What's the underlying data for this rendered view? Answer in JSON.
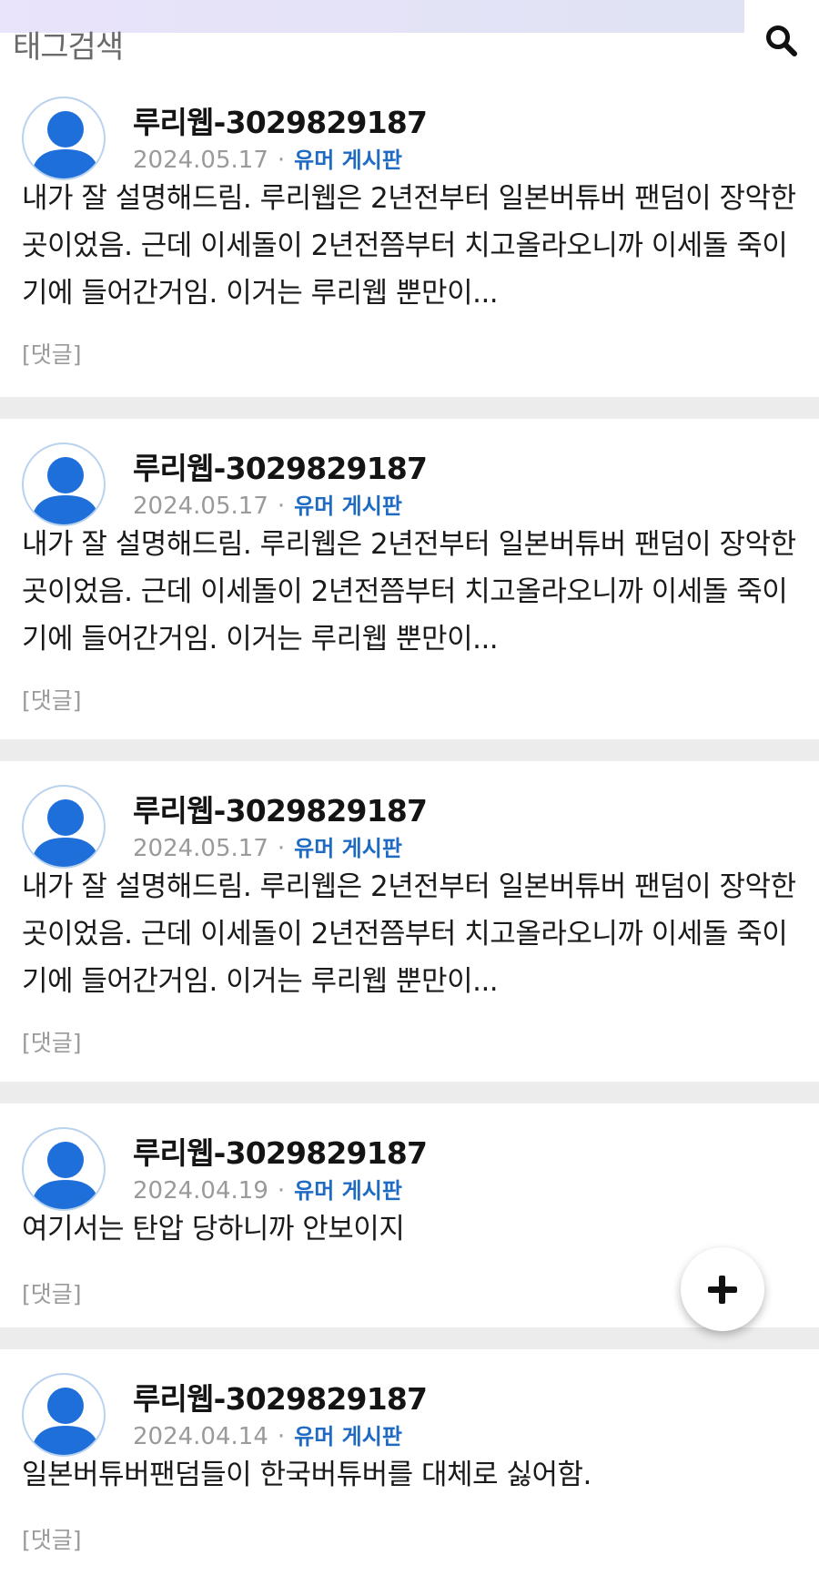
{
  "header": {
    "search_label": "태그검색",
    "search_icon": "search-icon"
  },
  "posts": [
    {
      "author": "루리웹-3029829187",
      "date": "2024.05.17",
      "separator": "·",
      "board": "유머 게시판",
      "body": "내가 잘 설명해드림. 루리웹은 2년전부터 일본버튜버 팬덤이 장악한 곳이었음. 근데 이세돌이 2년전쯤부터 치고올라오니까 이세돌 죽이기에 들어간거임. 이거는 루리웹 뿐만이...",
      "comment": "[댓글]"
    },
    {
      "author": "루리웹-3029829187",
      "date": "2024.05.17",
      "separator": "·",
      "board": "유머 게시판",
      "body": "내가 잘 설명해드림. 루리웹은 2년전부터 일본버튜버 팬덤이 장악한 곳이었음. 근데 이세돌이 2년전쯤부터 치고올라오니까 이세돌 죽이기에 들어간거임. 이거는 루리웹 뿐만이...",
      "comment": "[댓글]"
    },
    {
      "author": "루리웹-3029829187",
      "date": "2024.05.17",
      "separator": "·",
      "board": "유머 게시판",
      "body": "내가 잘 설명해드림. 루리웹은 2년전부터 일본버튜버 팬덤이 장악한 곳이었음. 근데 이세돌이 2년전쯤부터 치고올라오니까 이세돌 죽이기에 들어간거임. 이거는 루리웹 뿐만이...",
      "comment": "[댓글]"
    },
    {
      "author": "루리웹-3029829187",
      "date": "2024.04.19",
      "separator": "·",
      "board": "유머 게시판",
      "body": "여기서는 탄압 당하니까 안보이지",
      "comment": "[댓글]"
    },
    {
      "author": "루리웹-3029829187",
      "date": "2024.04.14",
      "separator": "·",
      "board": "유머 게시판",
      "body": "일본버튜버팬덤들이 한국버튜버를 대체로 싫어함.",
      "comment": "[댓글]"
    }
  ],
  "fab": {
    "icon": "plus-icon"
  },
  "colors": {
    "accent": "#1f6bc4",
    "avatar": "#1e6fd9",
    "divider": "#ececec",
    "muted": "#9a9a9a"
  }
}
